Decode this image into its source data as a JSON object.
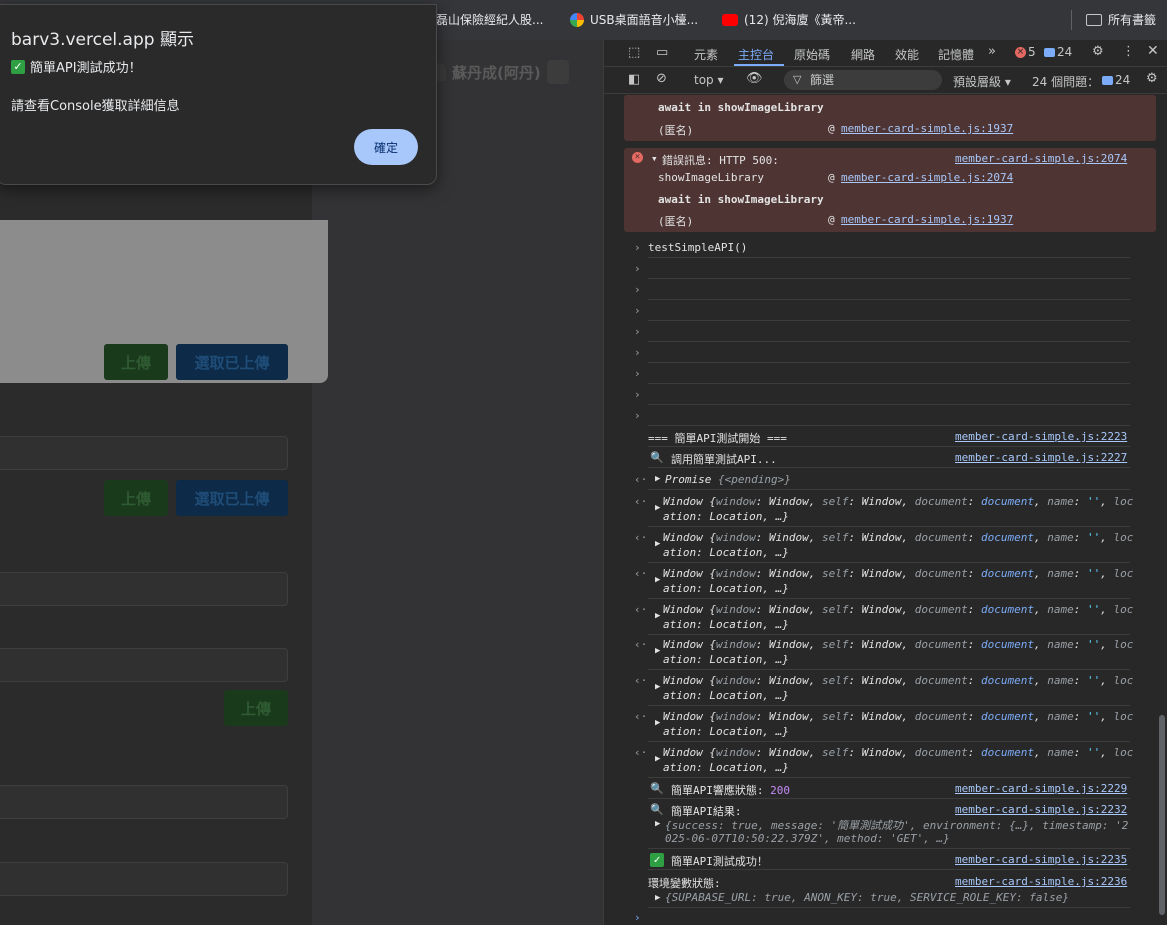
{
  "bookmarks": {
    "items": [
      {
        "label": "磊山保險經紀人股..."
      },
      {
        "label": "USB桌面語音小檯..."
      },
      {
        "label": "(12) 倪海廈《黃帝..."
      }
    ],
    "all_bookmarks": "所有書籤"
  },
  "page": {
    "header_name": "蘇丹成(阿丹)",
    "buttons": {
      "upload": "上傳",
      "select_uploaded": "選取已上傳"
    }
  },
  "alert": {
    "title": "barv3.vercel.app 顯示",
    "line1": "簡單API測試成功！",
    "line2": "請查看Console獲取詳細信息",
    "ok": "確定"
  },
  "devtools": {
    "tabs": [
      "元素",
      "主控台",
      "原始碼",
      "網路",
      "效能",
      "記憶體"
    ],
    "error_count": "5",
    "message_count": "24",
    "toolbar": {
      "context": "top",
      "filter_placeholder": "篩選",
      "levels": "預設層級",
      "issues": "24 個問題：",
      "issues_count": "24"
    }
  },
  "console": {
    "err1": {
      "line1": "await in showImageLibrary",
      "line2": "(匿名)",
      "line2_link": "member-card-simple.js:1937"
    },
    "err2": {
      "title": "錯誤訊息: HTTP 500:",
      "title_link": "member-card-simple.js:2074",
      "frame1": "showImageLibrary",
      "frame1_link": "member-card-simple.js:2074",
      "frame2": "await in showImageLibrary",
      "frame3": "(匿名)",
      "frame3_link": "member-card-simple.js:1937"
    },
    "command": "testSimpleAPI()",
    "log_start": "=== 簡單API測試開始 ===",
    "log_start_link": "member-card-simple.js:2223",
    "log_call": "調用簡單測試API...",
    "log_call_link": "member-card-simple.js:2227",
    "promise": "Promise",
    "promise_state": "{<pending>}",
    "window_line1_a": "Window {",
    "window_line2": "ation: Location, …}",
    "log_status": "簡單API響應狀態:",
    "log_status_value": "200",
    "log_status_link": "member-card-simple.js:2229",
    "log_result": "簡單API結果:",
    "log_result_link": "member-card-simple.js:2232",
    "result_obj_line1": "{success: true, message: '簡單測試成功', environment: {…}, timestamp: '2",
    "result_obj_line2": "025-06-07T10:50:22.379Z', method: 'GET', …}",
    "log_success": "簡單API測試成功！",
    "log_success_link": "member-card-simple.js:2235",
    "log_env": "環境變數狀態:",
    "log_env_link": "member-card-simple.js:2236",
    "env_obj": "{SUPABASE_URL: true, ANON_KEY: true, SERVICE_ROLE_KEY: false}"
  },
  "colors": {
    "accent": "#7cacf8",
    "error_bg": "#4e3534",
    "ok_button": "#a8c7fa"
  }
}
